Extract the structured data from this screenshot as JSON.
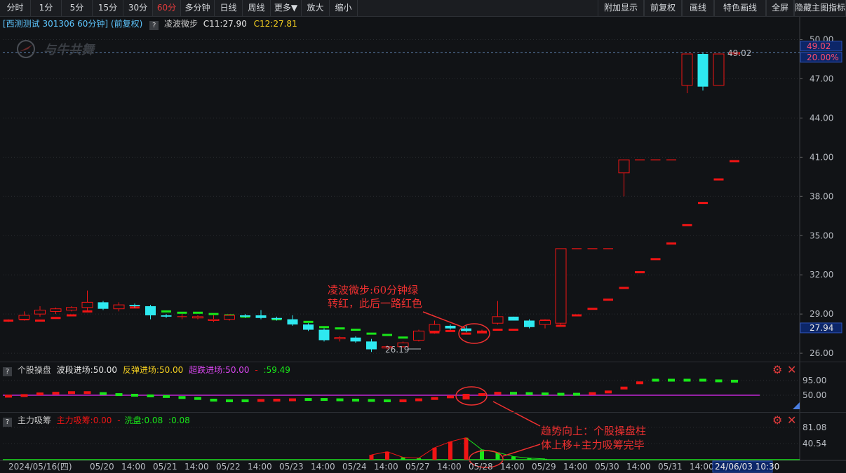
{
  "toolbar": {
    "left": [
      "分时",
      "1分",
      "5分",
      "15分",
      "30分",
      "60分",
      "多分钟",
      "日线",
      "周线",
      "更多▼",
      "放大",
      "缩小"
    ],
    "active": "60分",
    "right": [
      "附加显示",
      "前复权",
      "画线",
      "特色画线",
      "全屏",
      "隐藏主图指标"
    ]
  },
  "main": {
    "stock_label": "[西测测试 301306 60分钟]",
    "adjust_label": "(前复权)",
    "indicator_name": "凌波微步",
    "c1": "C11:27.90",
    "c2": "C12:27.81",
    "watermark": "与牛共舞",
    "hline_value": "49.02",
    "hline_pct": "20.00%",
    "current_price": "27.94",
    "low_label": "26.19",
    "high_label": "49.02",
    "annotation": [
      "凌波微步:60分钟绿",
      "转红，此后一路红色"
    ]
  },
  "panel2": {
    "name": "个股操盘",
    "v1": "波段进场:50.00",
    "v2": "反弹进场:50.00",
    "v3": "超跌进场:50.00",
    "v4": ":59.49",
    "ticks": [
      "95.00",
      "50.00"
    ]
  },
  "panel3": {
    "name": "主力吸筹",
    "v1": "主力吸筹:0.00",
    "v2": "洗盘:0.08",
    "v3": ":0.08",
    "ticks": [
      "81.08",
      "40.54"
    ],
    "annotation": [
      "趋势向上：个股操盘柱",
      "体上移+主力吸筹完毕"
    ]
  },
  "y_axis": [
    "50.00",
    "47.00",
    "44.00",
    "41.00",
    "38.00",
    "35.00",
    "32.00",
    "29.00",
    "26.00"
  ],
  "x_axis": [
    "2024/05/16(四)",
    "05/20",
    "14:00",
    "05/21",
    "14:00",
    "05/22",
    "14:00",
    "05/23",
    "14:00",
    "05/24",
    "14:00",
    "05/27",
    "14:00",
    "05/28",
    "14:00",
    "05/29",
    "14:00",
    "05/30",
    "14:00",
    "05/31",
    "14:00",
    "24/06/03 10:30"
  ],
  "chart_data": {
    "type": "candlestick",
    "candles": [
      [
        28.5,
        28.6,
        28.4,
        28.5
      ],
      [
        28.6,
        29.2,
        28.5,
        28.9
      ],
      [
        29.0,
        29.6,
        28.8,
        29.3
      ],
      [
        29.2,
        29.5,
        29.0,
        29.4
      ],
      [
        29.3,
        29.6,
        29.2,
        29.5
      ],
      [
        29.5,
        30.8,
        29.2,
        29.9
      ],
      [
        29.9,
        30.0,
        29.3,
        29.4
      ],
      [
        29.4,
        29.9,
        29.2,
        29.7
      ],
      [
        29.7,
        29.8,
        29.5,
        29.6
      ],
      [
        29.6,
        29.7,
        28.6,
        28.9
      ],
      [
        28.9,
        29.0,
        28.7,
        28.8
      ],
      [
        28.8,
        29.0,
        28.6,
        28.8
      ],
      [
        28.7,
        28.9,
        28.6,
        28.8
      ],
      [
        28.5,
        28.9,
        28.4,
        28.6
      ],
      [
        28.6,
        29.0,
        28.5,
        28.9
      ],
      [
        28.9,
        29.0,
        28.7,
        28.8
      ],
      [
        28.9,
        29.3,
        28.6,
        28.7
      ],
      [
        28.7,
        28.8,
        28.5,
        28.6
      ],
      [
        28.6,
        28.9,
        28.1,
        28.2
      ],
      [
        28.2,
        28.3,
        27.7,
        27.8
      ],
      [
        27.8,
        27.9,
        26.9,
        27.0
      ],
      [
        27.1,
        27.3,
        26.9,
        27.2
      ],
      [
        27.2,
        27.3,
        26.8,
        26.9
      ],
      [
        26.9,
        27.1,
        26.1,
        26.3
      ],
      [
        26.4,
        26.6,
        26.3,
        26.5
      ],
      [
        26.5,
        26.9,
        26.4,
        26.8
      ],
      [
        27.0,
        27.8,
        26.9,
        27.7
      ],
      [
        27.7,
        28.5,
        27.5,
        28.2
      ],
      [
        28.1,
        28.2,
        27.8,
        27.9
      ],
      [
        27.9,
        28.1,
        27.6,
        27.7
      ],
      [
        27.7,
        27.8,
        27.6,
        27.7
      ],
      [
        28.3,
        30.0,
        28.2,
        28.8
      ],
      [
        28.8,
        28.8,
        28.5,
        28.5
      ],
      [
        28.5,
        28.6,
        27.9,
        28.0
      ],
      [
        28.2,
        28.6,
        27.9,
        28.5
      ],
      [
        28.3,
        34.0,
        28.2,
        34.0
      ],
      [
        34.0,
        34.0,
        34.0,
        34.0
      ],
      [
        34.0,
        34.0,
        34.0,
        34.0
      ],
      [
        34.0,
        34.0,
        34.0,
        34.0
      ],
      [
        39.8,
        40.8,
        38.0,
        40.8
      ],
      [
        40.8,
        40.8,
        40.8,
        40.8
      ],
      [
        40.8,
        40.8,
        40.8,
        40.8
      ],
      [
        40.8,
        40.8,
        40.8,
        40.8
      ],
      [
        46.5,
        48.9,
        45.9,
        48.9
      ],
      [
        48.9,
        49.0,
        46.1,
        46.4
      ],
      [
        46.5,
        48.9,
        46.5,
        48.9
      ],
      [
        48.9,
        49.0,
        48.9,
        49.0
      ]
    ],
    "lingbo": [
      [
        28.5,
        "r"
      ],
      [
        28.6,
        "r"
      ],
      [
        28.5,
        "r"
      ],
      [
        28.7,
        "r"
      ],
      [
        28.9,
        "r"
      ],
      [
        29.2,
        "r"
      ],
      [
        29.6,
        "r"
      ],
      [
        29.5,
        "r"
      ],
      [
        29.5,
        "r"
      ],
      [
        29.2,
        "g"
      ],
      [
        29.2,
        "g"
      ],
      [
        29.1,
        "g"
      ],
      [
        29.1,
        "g"
      ],
      [
        29.0,
        "g"
      ],
      [
        28.9,
        "g"
      ],
      [
        28.8,
        "g"
      ],
      [
        28.8,
        "g"
      ],
      [
        28.6,
        "g"
      ],
      [
        28.4,
        "g"
      ],
      [
        28.4,
        "g"
      ],
      [
        28.0,
        "g"
      ],
      [
        27.9,
        "g"
      ],
      [
        27.8,
        "g"
      ],
      [
        27.5,
        "g"
      ],
      [
        27.4,
        "g"
      ],
      [
        27.2,
        "g"
      ],
      [
        27.4,
        "g"
      ],
      [
        27.6,
        "r"
      ],
      [
        27.7,
        "r"
      ],
      [
        27.5,
        "r"
      ],
      [
        27.6,
        "r"
      ],
      [
        27.8,
        "r"
      ],
      [
        27.8,
        "r"
      ],
      [
        28.2,
        "r"
      ],
      [
        28.5,
        "r"
      ],
      [
        28.1,
        "r"
      ],
      [
        28.9,
        "r"
      ],
      [
        29.4,
        "r"
      ],
      [
        30.1,
        "r"
      ],
      [
        31.0,
        "r"
      ],
      [
        32.2,
        "r"
      ],
      [
        33.2,
        "r"
      ],
      [
        34.4,
        "r"
      ],
      [
        35.8,
        "r"
      ],
      [
        37.5,
        "r"
      ],
      [
        39.3,
        "r"
      ],
      [
        40.7,
        "r"
      ]
    ],
    "panel2_bars": [
      [
        47,
        "r"
      ],
      [
        49,
        "r"
      ],
      [
        54,
        "r"
      ],
      [
        56,
        "r"
      ],
      [
        58,
        "r"
      ],
      [
        58,
        "r"
      ],
      [
        55,
        "g"
      ],
      [
        52,
        "g"
      ],
      [
        50,
        "g"
      ],
      [
        48,
        "g"
      ],
      [
        46,
        "g"
      ],
      [
        43,
        "g"
      ],
      [
        40,
        "g"
      ],
      [
        35,
        "g"
      ],
      [
        33,
        "g"
      ],
      [
        33,
        "g"
      ],
      [
        34,
        "r"
      ],
      [
        35,
        "r"
      ],
      [
        36,
        "r"
      ],
      [
        37,
        "g"
      ],
      [
        37,
        "g"
      ],
      [
        36,
        "g"
      ],
      [
        35,
        "g"
      ],
      [
        34,
        "g"
      ],
      [
        33,
        "g"
      ],
      [
        33,
        "r"
      ],
      [
        36,
        "r"
      ],
      [
        40,
        "r"
      ],
      [
        45,
        "r"
      ],
      [
        50,
        "r"
      ],
      [
        52,
        "r"
      ],
      [
        56,
        "r"
      ],
      [
        56,
        "g"
      ],
      [
        55,
        "g"
      ],
      [
        54,
        "g"
      ],
      [
        53,
        "g"
      ],
      [
        53,
        "g"
      ],
      [
        55,
        "r"
      ],
      [
        60,
        "r"
      ],
      [
        72,
        "r"
      ],
      [
        88,
        "r"
      ],
      [
        96,
        "g"
      ],
      [
        96,
        "g"
      ],
      [
        96,
        "g"
      ],
      [
        96,
        "g"
      ],
      [
        94,
        "g"
      ],
      [
        93,
        "g"
      ]
    ],
    "panel3_bars": [
      [
        0,
        "n"
      ],
      [
        0,
        "n"
      ],
      [
        0,
        "n"
      ],
      [
        0,
        "n"
      ],
      [
        0,
        "n"
      ],
      [
        0,
        "n"
      ],
      [
        0,
        "n"
      ],
      [
        0,
        "n"
      ],
      [
        0,
        "n"
      ],
      [
        0,
        "n"
      ],
      [
        0,
        "n"
      ],
      [
        0,
        "n"
      ],
      [
        0,
        "n"
      ],
      [
        0,
        "n"
      ],
      [
        0,
        "n"
      ],
      [
        0,
        "n"
      ],
      [
        0,
        "n"
      ],
      [
        0,
        "n"
      ],
      [
        0,
        "n"
      ],
      [
        0,
        "n"
      ],
      [
        0,
        "n"
      ],
      [
        0,
        "n"
      ],
      [
        0,
        "n"
      ],
      [
        12,
        "r"
      ],
      [
        20,
        "r"
      ],
      [
        6,
        "g"
      ],
      [
        4,
        "g"
      ],
      [
        30,
        "r"
      ],
      [
        45,
        "r"
      ],
      [
        55,
        "r"
      ],
      [
        25,
        "g"
      ],
      [
        18,
        "g"
      ],
      [
        8,
        "g"
      ],
      [
        4,
        "g"
      ],
      [
        2,
        "g"
      ],
      [
        0,
        "n"
      ],
      [
        0,
        "n"
      ],
      [
        0,
        "n"
      ],
      [
        0,
        "n"
      ],
      [
        0,
        "n"
      ],
      [
        0,
        "n"
      ],
      [
        0,
        "n"
      ],
      [
        0,
        "n"
      ],
      [
        0,
        "n"
      ],
      [
        0,
        "n"
      ],
      [
        0,
        "n"
      ],
      [
        0,
        "n"
      ]
    ]
  },
  "colors": {
    "up": "#f01414",
    "down": "#2ee9f0",
    "green": "#19e619",
    "bg": "#111316",
    "grid": "#2a2d31",
    "purple": "#c026d3"
  }
}
